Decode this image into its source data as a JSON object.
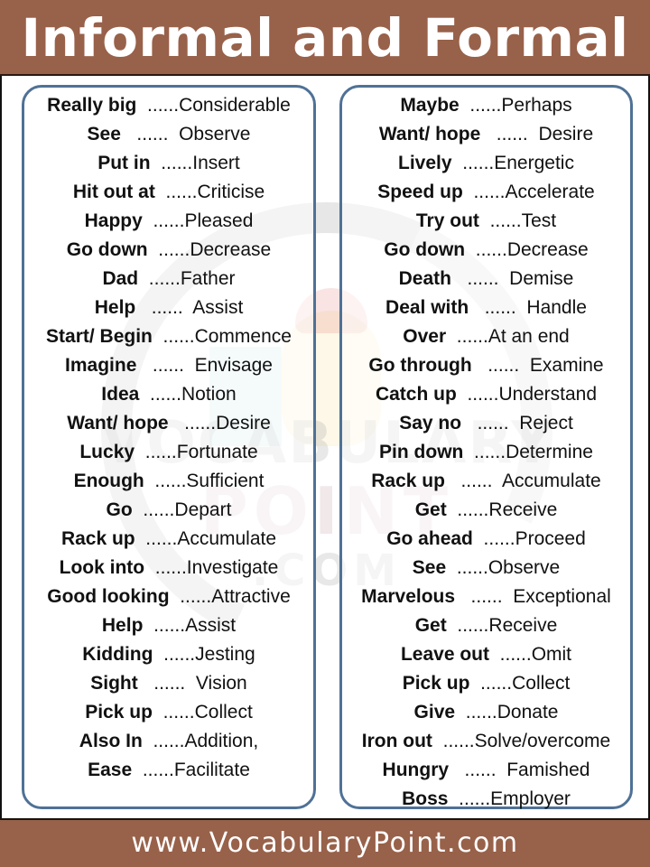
{
  "header": {
    "title": "Informal and Formal"
  },
  "footer": {
    "website": "www.VocabularyPoint.com"
  },
  "watermark": {
    "line1": "VOCABULARY",
    "line2": "POINT",
    "line3": ".COM"
  },
  "colors": {
    "brand_brown": "#98614a",
    "panel_border": "#4f7196",
    "text": "#111111"
  },
  "left_column": [
    {
      "informal": "Really big",
      "sep": "  ......",
      "formal": "Considerable"
    },
    {
      "informal": "See",
      "sep": "   ......  ",
      "formal": "Observe"
    },
    {
      "informal": "Put in",
      "sep": "  ......",
      "formal": "Insert"
    },
    {
      "informal": "Hit out at",
      "sep": "  ......",
      "formal": "Criticise"
    },
    {
      "informal": "Happy",
      "sep": "  ......",
      "formal": "Pleased"
    },
    {
      "informal": "Go down",
      "sep": "  ......",
      "formal": "Decrease"
    },
    {
      "informal": "Dad",
      "sep": "  ......",
      "formal": "Father"
    },
    {
      "informal": "Help",
      "sep": "   ......  ",
      "formal": "Assist"
    },
    {
      "informal": "Start/ Begin",
      "sep": "  ......",
      "formal": "Commence"
    },
    {
      "informal": "Imagine",
      "sep": "   ......  ",
      "formal": "Envisage"
    },
    {
      "informal": "Idea",
      "sep": "  ......",
      "formal": "Notion"
    },
    {
      "informal": "Want/ hope",
      "sep": "   ......",
      "formal": "Desire"
    },
    {
      "informal": "Lucky",
      "sep": "  ......",
      "formal": "Fortunate"
    },
    {
      "informal": "Enough",
      "sep": "  ......",
      "formal": "Sufficient"
    },
    {
      "informal": "Go",
      "sep": "  ......",
      "formal": "Depart"
    },
    {
      "informal": "Rack up",
      "sep": "  ......",
      "formal": "Accumulate"
    },
    {
      "informal": "Look into",
      "sep": "  ......",
      "formal": "Investigate"
    },
    {
      "informal": "Good looking",
      "sep": "  ......",
      "formal": "Attractive"
    },
    {
      "informal": "Help",
      "sep": "  ......",
      "formal": "Assist"
    },
    {
      "informal": "Kidding",
      "sep": "  ......",
      "formal": "Jesting"
    },
    {
      "informal": "Sight",
      "sep": "   ......  ",
      "formal": "Vision"
    },
    {
      "informal": "Pick up",
      "sep": "  ......",
      "formal": "Collect"
    },
    {
      "informal": "Also In",
      "sep": "  ......",
      "formal": "Addition,"
    },
    {
      "informal": "Ease",
      "sep": "  ......",
      "formal": "Facilitate"
    }
  ],
  "right_column": [
    {
      "informal": "Maybe",
      "sep": "  ......",
      "formal": "Perhaps"
    },
    {
      "informal": "Want/ hope",
      "sep": "   ......  ",
      "formal": "Desire"
    },
    {
      "informal": "Lively",
      "sep": "  ......",
      "formal": "Energetic"
    },
    {
      "informal": "Speed up",
      "sep": "  ......",
      "formal": "Accelerate"
    },
    {
      "informal": "Try out",
      "sep": "  ......",
      "formal": "Test"
    },
    {
      "informal": "Go down",
      "sep": "  ......",
      "formal": "Decrease"
    },
    {
      "informal": "Death",
      "sep": "   ......  ",
      "formal": "Demise"
    },
    {
      "informal": "Deal with",
      "sep": "   ......  ",
      "formal": "Handle"
    },
    {
      "informal": "Over",
      "sep": "  ......",
      "formal": "At an end"
    },
    {
      "informal": "Go through",
      "sep": "   ......  ",
      "formal": "Examine"
    },
    {
      "informal": "Catch up",
      "sep": "  ......",
      "formal": "Understand"
    },
    {
      "informal": "Say no",
      "sep": "   ......  ",
      "formal": "Reject"
    },
    {
      "informal": "Pin down",
      "sep": "  ......",
      "formal": "Determine"
    },
    {
      "informal": "Rack up",
      "sep": "   ......  ",
      "formal": "Accumulate"
    },
    {
      "informal": "Get",
      "sep": "  ......",
      "formal": "Receive"
    },
    {
      "informal": "Go ahead",
      "sep": "  ......",
      "formal": "Proceed"
    },
    {
      "informal": "See",
      "sep": "  ......",
      "formal": "Observe"
    },
    {
      "informal": "Marvelous",
      "sep": "   ......  ",
      "formal": "Exceptional"
    },
    {
      "informal": "Get",
      "sep": "  ......",
      "formal": "Receive"
    },
    {
      "informal": "Leave out",
      "sep": "  ......",
      "formal": "Omit"
    },
    {
      "informal": "Pick up",
      "sep": "  ......",
      "formal": "Collect"
    },
    {
      "informal": "Give",
      "sep": "  ......",
      "formal": "Donate"
    },
    {
      "informal": "Iron out",
      "sep": "  ......",
      "formal": "Solve/overcome"
    },
    {
      "informal": "Hungry",
      "sep": "   ......  ",
      "formal": "Famished"
    },
    {
      "informal": "Boss",
      "sep": "  ......",
      "formal": "Employer"
    }
  ]
}
